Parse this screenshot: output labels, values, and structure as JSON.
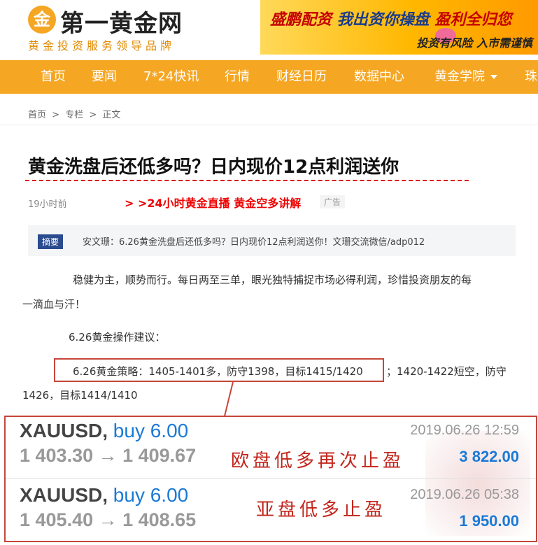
{
  "header": {
    "logo_glyph": "金",
    "logo_name": "第一黄金网",
    "slogan": "黄金投资服务领导品牌",
    "banner": {
      "line1_part1": "盛鹏配资",
      "line1_part2": "我出资你操盘",
      "line1_part3": "盈利全归您",
      "line2": "投资有风险 入市需谨慎"
    }
  },
  "nav": {
    "items": [
      "首页",
      "要闻",
      "7*24快讯",
      "行情",
      "财经日历",
      "数据中心",
      "黄金学院",
      "珠"
    ]
  },
  "breadcrumb": [
    "首页",
    ">",
    "专栏",
    ">",
    "正文"
  ],
  "article": {
    "title": "黄金洗盘后还低多吗？日内现价12点利润送你",
    "time": "19小时前",
    "live_link": "> >24小时黄金直播 黄金空多讲解",
    "ad_tag": "广告",
    "summary_badge": "摘要",
    "summary_text": "安文珊：6.26黄金洗盘后还低多吗？日内现价12点利润送你！文珊交流微信/adp012",
    "p1_line1": "稳健为主，顺势而行。每日两至三单，眼光独特捕捉市场必得利润，珍惜投资朋友的每",
    "p1_line2": "一滴血与汗！",
    "p2": "6.26黄金操作建议：",
    "p3_boxed": "6.26黄金策略：1405-1401多，防守1398，目标1415/1420",
    "p3_rest": "；1420-1422短空，防守",
    "p3_line2": "1426，目标1414/1410"
  },
  "trades": [
    {
      "symbol": "XAUUSD,",
      "side": "buy 6.00",
      "prices": "1 403.30 → 1 409.67",
      "datetime": "2019.06.26 12:59",
      "profit": "3 822.00",
      "note": "欧盘低多再次止盈"
    },
    {
      "symbol": "XAUUSD,",
      "side": "buy 6.00",
      "prices": "1 405.40 → 1 408.65",
      "datetime": "2019.06.26 05:38",
      "profit": "1 950.00",
      "note": "亚盘低多止盈"
    }
  ],
  "colors": {
    "brand_orange": "#f5a623",
    "title_red": "#d00000",
    "link_red": "#e00000",
    "annotation_red": "#c6463a",
    "buy_blue": "#1a7ad6"
  }
}
